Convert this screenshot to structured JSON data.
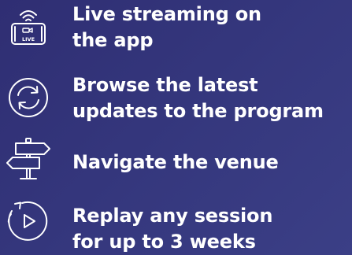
{
  "colors": {
    "background": "#34367c",
    "text": "#ffffff",
    "icon_stroke": "#ffffff"
  },
  "features": [
    {
      "icon": "live-streaming-phone-icon",
      "lines": [
        "Live streaming on",
        "the app"
      ],
      "icon_label": "LIVE"
    },
    {
      "icon": "refresh-cycle-icon",
      "lines": [
        "Browse the latest",
        "updates to the program"
      ]
    },
    {
      "icon": "signpost-icon",
      "lines": [
        "Navigate the venue"
      ]
    },
    {
      "icon": "replay-icon",
      "lines": [
        "Replay any session",
        "for up to 3 weeks"
      ]
    }
  ]
}
